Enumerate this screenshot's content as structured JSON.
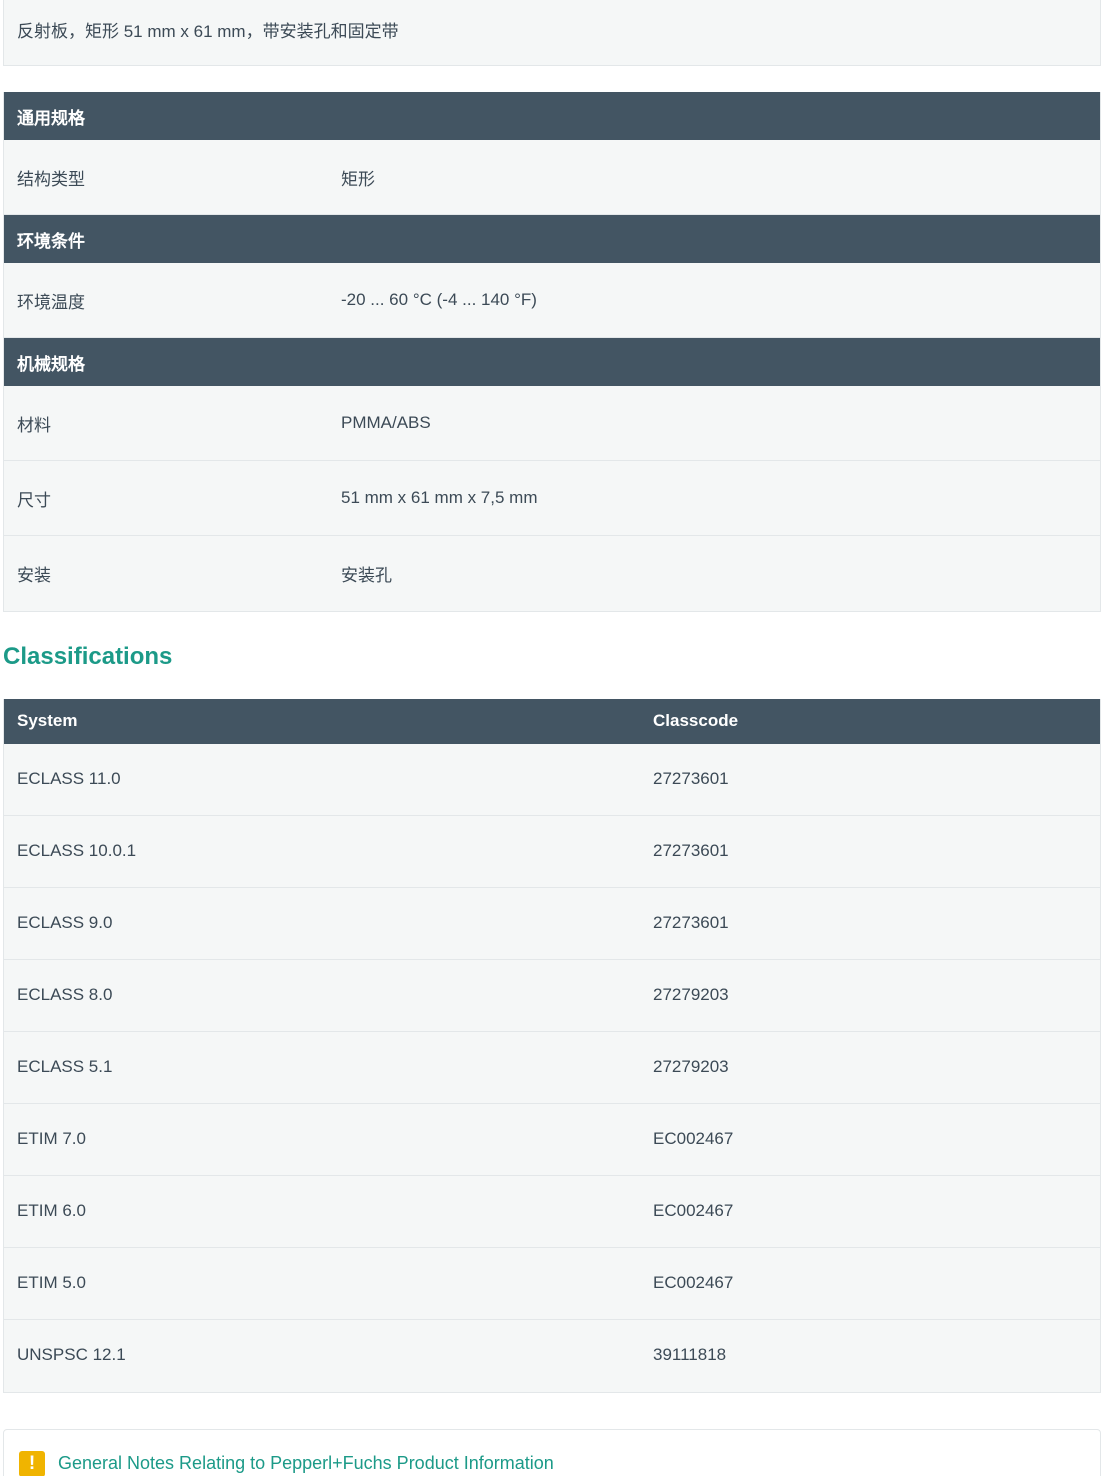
{
  "description": "反射板，矩形 51 mm x 61 mm，带安装孔和固定带",
  "spec_sections": [
    {
      "title": "通用规格",
      "rows": [
        {
          "label": "结构类型",
          "value": "矩形"
        }
      ]
    },
    {
      "title": "环境条件",
      "rows": [
        {
          "label": "环境温度",
          "value": "-20 ... 60 °C (-4 ... 140 °F)"
        }
      ]
    },
    {
      "title": "机械规格",
      "rows": [
        {
          "label": "材料",
          "value": "PMMA/ABS"
        },
        {
          "label": "尺寸",
          "value": "51 mm x 61 mm x 7,5 mm"
        },
        {
          "label": "安装",
          "value": "安装孔"
        }
      ]
    }
  ],
  "classifications": {
    "title": "Classifications",
    "headers": {
      "system": "System",
      "classcode": "Classcode"
    },
    "rows": [
      {
        "system": "ECLASS 11.0",
        "code": "27273601"
      },
      {
        "system": "ECLASS 10.0.1",
        "code": "27273601"
      },
      {
        "system": "ECLASS 9.0",
        "code": "27273601"
      },
      {
        "system": "ECLASS 8.0",
        "code": "27279203"
      },
      {
        "system": "ECLASS 5.1",
        "code": "27279203"
      },
      {
        "system": "ETIM 7.0",
        "code": "EC002467"
      },
      {
        "system": "ETIM 6.0",
        "code": "EC002467"
      },
      {
        "system": "ETIM 5.0",
        "code": "EC002467"
      },
      {
        "system": "UNSPSC 12.1",
        "code": "39111818"
      }
    ]
  },
  "notes": {
    "icon": "warning-icon",
    "icon_glyph": "!",
    "link": "General Notes Relating to Pepperl+Fuchs Product Information"
  },
  "colors": {
    "header_bg": "#435563",
    "row_bg": "#f5f7f7",
    "accent": "#1c9a88",
    "warning": "#f0b400"
  }
}
